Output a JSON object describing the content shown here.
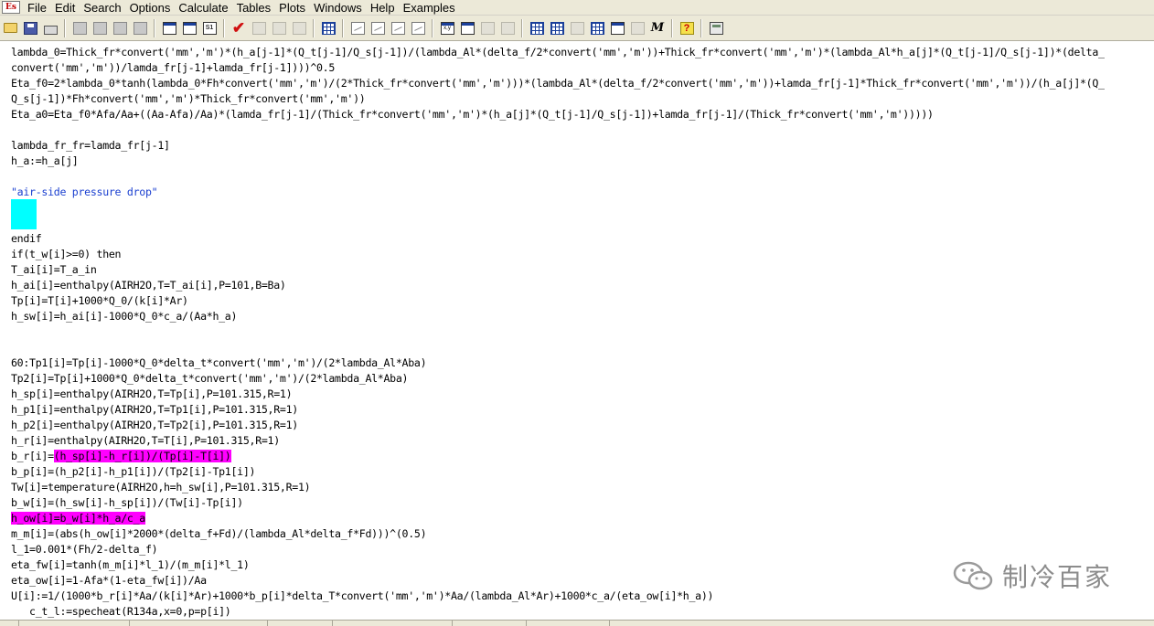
{
  "app": {
    "logo_text": "Es"
  },
  "menu": [
    "File",
    "Edit",
    "Search",
    "Options",
    "Calculate",
    "Tables",
    "Plots",
    "Windows",
    "Help",
    "Examples"
  ],
  "toolbar": {
    "icons": [
      "open-icon",
      "save-icon",
      "print-icon",
      "cut-icon",
      "copy-icon",
      "paste-icon",
      "format-icon",
      "equations-window-icon",
      "formatted-equations-icon",
      "solution-window-icon",
      "check-icon",
      "residuals-icon",
      "arrays-icon",
      "integral-table-icon",
      "parametric-table-icon",
      "plot-1-icon",
      "plot-2-icon",
      "plot-3-icon",
      "plot-4-icon",
      "xy-icon",
      "array-table-icon",
      "lookup-table-icon",
      "diagram-icon",
      "table-1-icon",
      "table-2-icon",
      "table-3-icon",
      "table-4-icon",
      "image-icon",
      "units-icon",
      "mathcad-icon",
      "help-icon",
      "calculator-icon"
    ],
    "labels": {
      "s1": "S1",
      "xy": "x,y",
      "M": "M"
    }
  },
  "editor": {
    "lines": [
      "lambda_0=Thick_fr*convert('mm','m')*(h_a[j-1]*(Q_t[j-1]/Q_s[j-1])/(lambda_Al*(delta_f/2*convert('mm','m'))+Thick_fr*convert('mm','m')*(lambda_Al*h_a[j]*(Q_t[j-1]/Q_s[j-1])*(delta_",
      "convert('mm','m'))/lamda_fr[j-1]+lamda_fr[j-1])))^0.5",
      "Eta_f0=2*lambda_0*tanh(lambda_0*Fh*convert('mm','m')/(2*Thick_fr*convert('mm','m')))*(lambda_Al*(delta_f/2*convert('mm','m'))+lamda_fr[j-1]*Thick_fr*convert('mm','m'))/(h_a[j]*(Q_",
      "Q_s[j-1])*Fh*convert('mm','m')*Thick_fr*convert('mm','m'))",
      "Eta_a0=Eta_f0*Afa/Aa+((Aa-Afa)/Aa)*(lamda_fr[j-1]/(Thick_fr*convert('mm','m')*(h_a[j]*(Q_t[j-1]/Q_s[j-1])+lamda_fr[j-1]/(Thick_fr*convert('mm','m')))))",
      "",
      "lambda_fr_fr=lamda_fr[j-1]",
      "h_a:=h_a[j]",
      "",
      "\"air-side pressure drop\"",
      "",
      "",
      "",
      "endif",
      "if(t_w[i]>=0) then",
      "T_ai[i]=T_a_in",
      "h_ai[i]=enthalpy(AIRH2O,T=T_ai[i],P=101,B=Ba)",
      "Tp[i]=T[i]+1000*Q_0/(k[i]*Ar)",
      "h_sw[i]=h_ai[i]-1000*Q_0*c_a/(Aa*h_a)",
      "",
      "",
      "60:Tp1[i]=Tp[i]-1000*Q_0*delta_t*convert('mm','m')/(2*lambda_Al*Aba)",
      "Tp2[i]=Tp[i]+1000*Q_0*delta_t*convert('mm','m')/(2*lambda_Al*Aba)",
      "h_sp[i]=enthalpy(AIRH2O,T=Tp[i],P=101.315,R=1)",
      "h_p1[i]=enthalpy(AIRH2O,T=Tp1[i],P=101.315,R=1)",
      "h_p2[i]=enthalpy(AIRH2O,T=Tp2[i],P=101.315,R=1)",
      "h_r[i]=enthalpy(AIRH2O,T=T[i],P=101.315,R=1)",
      "b_r[i]=",
      "b_p[i]=(h_p2[i]-h_p1[i])/(Tp2[i]-Tp1[i])",
      "Tw[i]=temperature(AIRH2O,h=h_sw[i],P=101.315,R=1)",
      "b_w[i]=(h_sw[i]-h_sp[i])/(Tw[i]-Tp[i])",
      "",
      "m_m[i]=(abs(h_ow[i]*2000*(delta_f+Fd)/(lambda_Al*delta_f*Fd)))^(0.5)",
      "l_1=0.001*(Fh/2-delta_f)",
      "eta_fw[i]=tanh(m_m[i]*l_1)/(m_m[i]*l_1)",
      "eta_ow[i]=1-Afa*(1-eta_fw[i])/Aa",
      "U[i]:=1/(1000*b_r[i]*Aa/(k[i]*Ar)+1000*b_p[i]*delta_T*convert('mm','m')*Aa/(lambda_Al*Ar)+1000*c_a/(eta_ow[i]*h_a))",
      "   c_t_l:=specheat(R134a,x=0,p=p[i])"
    ],
    "highlight_1": "(h_sp[i]-h_r[i])/(Tp[i]-T[i])",
    "highlight_2": "h_ow[i]=b_w[i]*h_a/c_a",
    "colors": {
      "comment": "#1a3fd0",
      "highlight": "#ff00ff",
      "block": "#00ffff"
    }
  },
  "watermark": {
    "text": "制冷百家"
  }
}
